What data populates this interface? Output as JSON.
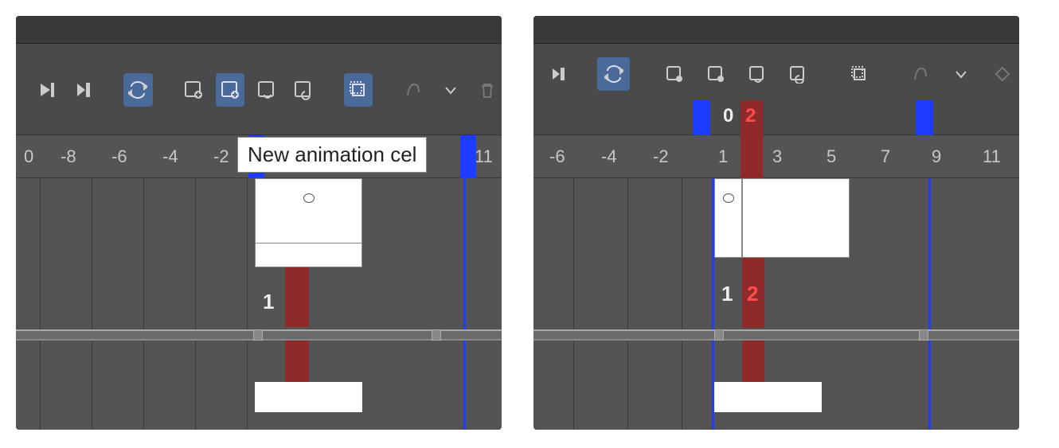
{
  "left": {
    "tooltip": "New animation cel",
    "ruler": {
      "ticks": [
        "0",
        "-8",
        "-6",
        "-4",
        "-2",
        "11"
      ]
    },
    "frame_label": "1"
  },
  "right": {
    "ruler": {
      "ticks": [
        "-6",
        "-4",
        "-2",
        "1",
        "3",
        "5",
        "7",
        "9",
        "11"
      ]
    },
    "ruler_top": {
      "zero": "0",
      "two": "2"
    },
    "frame_label_1": "1",
    "frame_label_2": "2"
  },
  "icons": {
    "play": "play-icon",
    "step": "step-forward-icon",
    "loop": "loop-icon",
    "cel_add": "new-cel-icon",
    "cel_new": "new-animation-cel-icon",
    "cel_link": "link-cel-icon",
    "cel_unlink": "unlink-cel-icon",
    "stack": "cel-stack-icon",
    "onion": "onion-skin-icon",
    "chevron": "chevron-down-icon",
    "trash": "trash-icon"
  }
}
